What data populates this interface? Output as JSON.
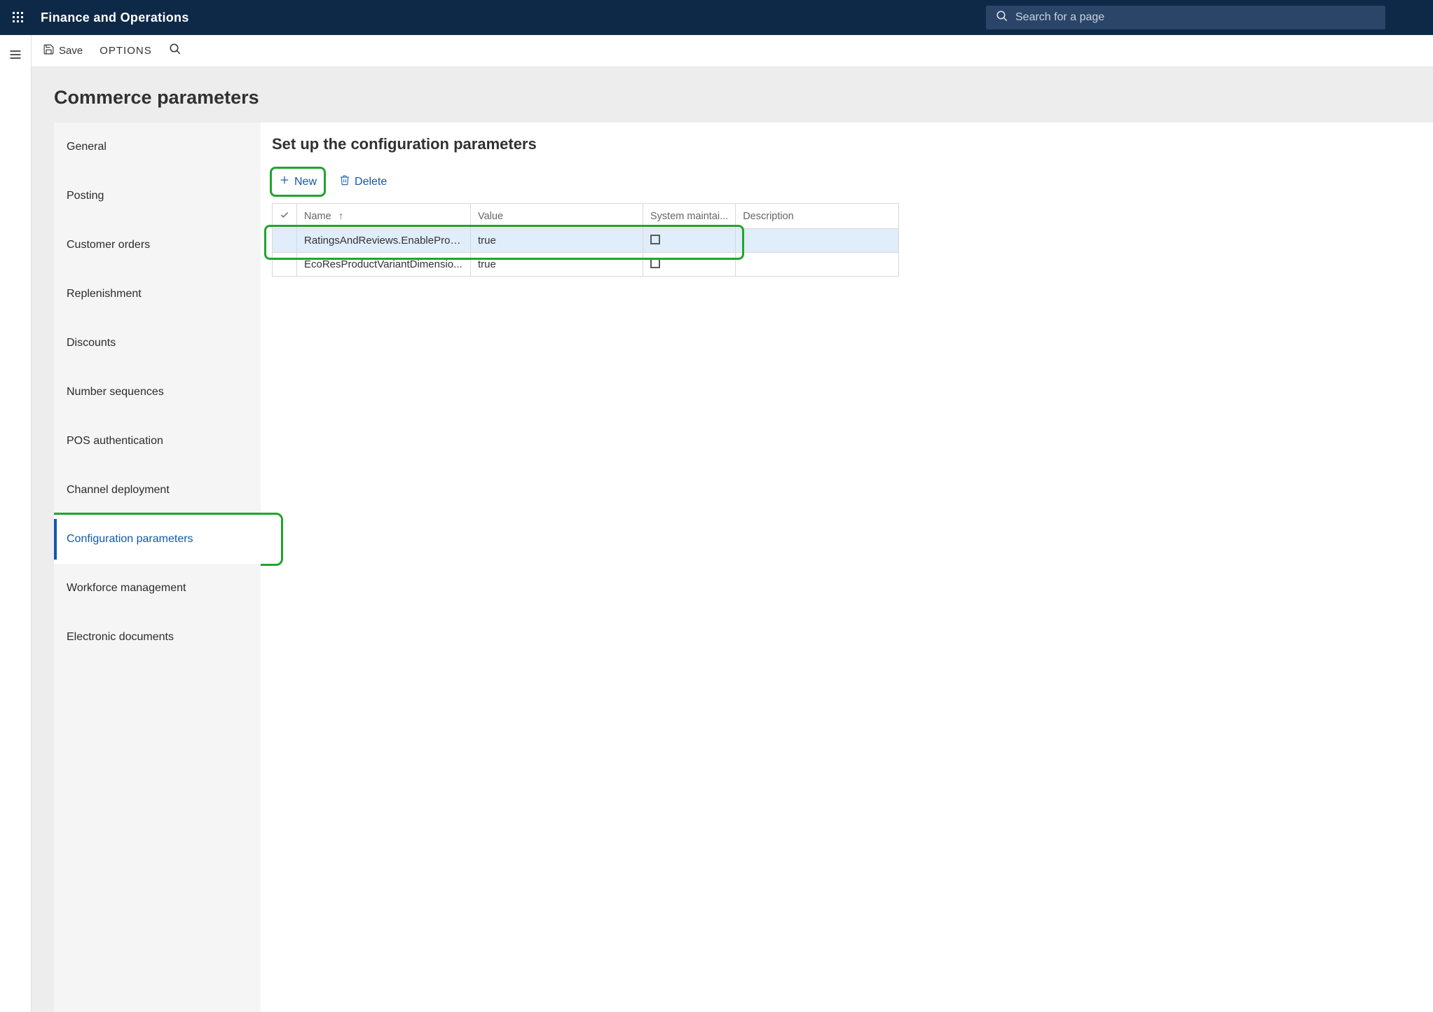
{
  "header": {
    "app_title": "Finance and Operations",
    "search_placeholder": "Search for a page"
  },
  "toolbar": {
    "save_label": "Save",
    "options_label": "OPTIONS"
  },
  "page": {
    "title": "Commerce parameters"
  },
  "sidebar": {
    "items": [
      {
        "label": "General"
      },
      {
        "label": "Posting"
      },
      {
        "label": "Customer orders"
      },
      {
        "label": "Replenishment"
      },
      {
        "label": "Discounts"
      },
      {
        "label": "Number sequences"
      },
      {
        "label": "POS authentication"
      },
      {
        "label": "Channel deployment"
      },
      {
        "label": "Configuration parameters"
      },
      {
        "label": "Workforce management"
      },
      {
        "label": "Electronic documents"
      }
    ],
    "active_index": 8
  },
  "main": {
    "section_title": "Set up the configuration parameters",
    "actions": {
      "new_label": "New",
      "delete_label": "Delete"
    },
    "columns": {
      "name": "Name",
      "value": "Value",
      "system": "System maintai...",
      "description": "Description"
    },
    "rows": [
      {
        "name": "RatingsAndReviews.EnableProd...",
        "value": "true",
        "system": false,
        "description": ""
      },
      {
        "name": "EcoResProductVariantDimensio...",
        "value": "true",
        "system": false,
        "description": ""
      }
    ],
    "selected_row_index": 0
  }
}
